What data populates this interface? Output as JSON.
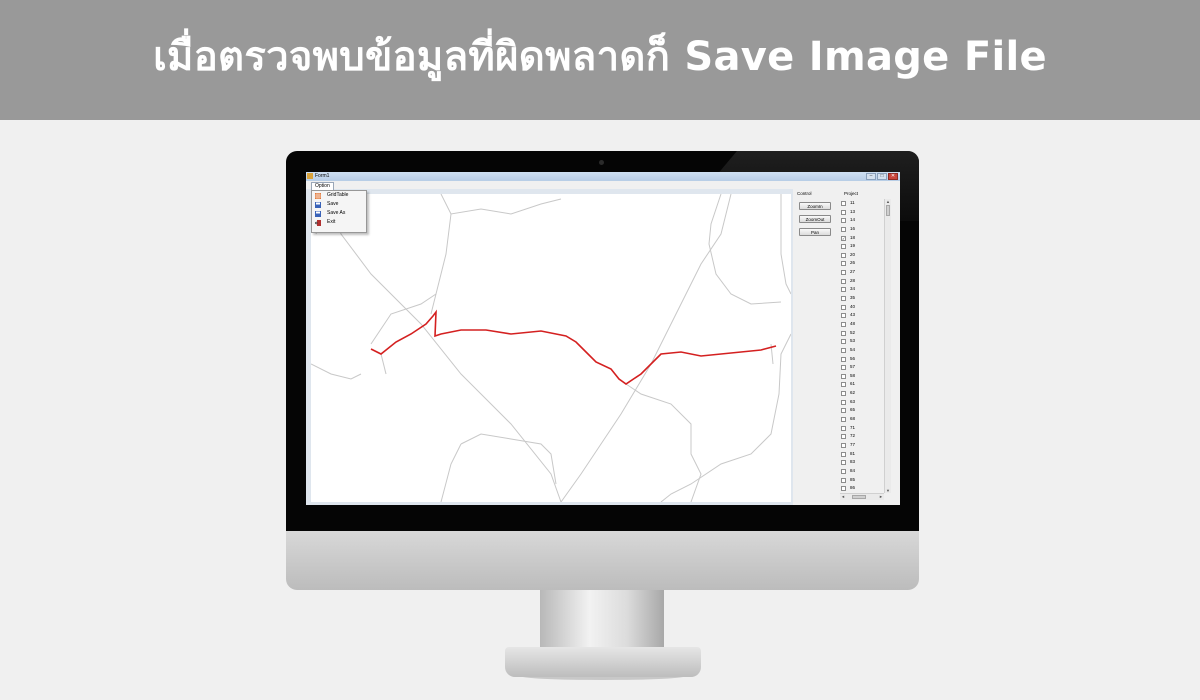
{
  "banner": {
    "title": "เมื่อตรวจพบข้อมูลที่ผิดพลาดก็ Save Image File"
  },
  "window": {
    "title": "Form1",
    "controls": {
      "minimize": "–",
      "maximize": "□",
      "close": "✕"
    }
  },
  "menu": {
    "option_label": "Option",
    "items": [
      {
        "label": "GridTable",
        "icon": "grid-table-icon"
      },
      {
        "label": "Save",
        "icon": "floppy-disk-icon"
      },
      {
        "label": "Save As",
        "icon": "floppy-disk-icon"
      },
      {
        "label": "Exit",
        "icon": "exit-door-icon"
      }
    ]
  },
  "control": {
    "label": "Control",
    "buttons": [
      "ZoomIn",
      "ZoomOut",
      "Pan"
    ]
  },
  "project": {
    "label": "Project",
    "items": [
      {
        "id": "11",
        "checked": false
      },
      {
        "id": "13",
        "checked": false
      },
      {
        "id": "14",
        "checked": false
      },
      {
        "id": "16",
        "checked": false
      },
      {
        "id": "18",
        "checked": true
      },
      {
        "id": "19",
        "checked": false
      },
      {
        "id": "20",
        "checked": false
      },
      {
        "id": "26",
        "checked": false
      },
      {
        "id": "27",
        "checked": false
      },
      {
        "id": "28",
        "checked": false
      },
      {
        "id": "34",
        "checked": false
      },
      {
        "id": "35",
        "checked": false
      },
      {
        "id": "40",
        "checked": false
      },
      {
        "id": "43",
        "checked": false
      },
      {
        "id": "48",
        "checked": false
      },
      {
        "id": "52",
        "checked": false
      },
      {
        "id": "53",
        "checked": false
      },
      {
        "id": "54",
        "checked": false
      },
      {
        "id": "56",
        "checked": false
      },
      {
        "id": "57",
        "checked": false
      },
      {
        "id": "58",
        "checked": false
      },
      {
        "id": "61",
        "checked": false
      },
      {
        "id": "62",
        "checked": false
      },
      {
        "id": "63",
        "checked": false
      },
      {
        "id": "65",
        "checked": false
      },
      {
        "id": "68",
        "checked": false
      },
      {
        "id": "71",
        "checked": false
      },
      {
        "id": "72",
        "checked": false
      },
      {
        "id": "77",
        "checked": false
      },
      {
        "id": "81",
        "checked": false
      },
      {
        "id": "83",
        "checked": false
      },
      {
        "id": "84",
        "checked": false
      },
      {
        "id": "85",
        "checked": false
      },
      {
        "id": "86",
        "checked": false
      }
    ]
  },
  "colors": {
    "banner_bg": "#999999",
    "highlight_route": "#d42020",
    "road_lines": "#c8c8c8"
  }
}
